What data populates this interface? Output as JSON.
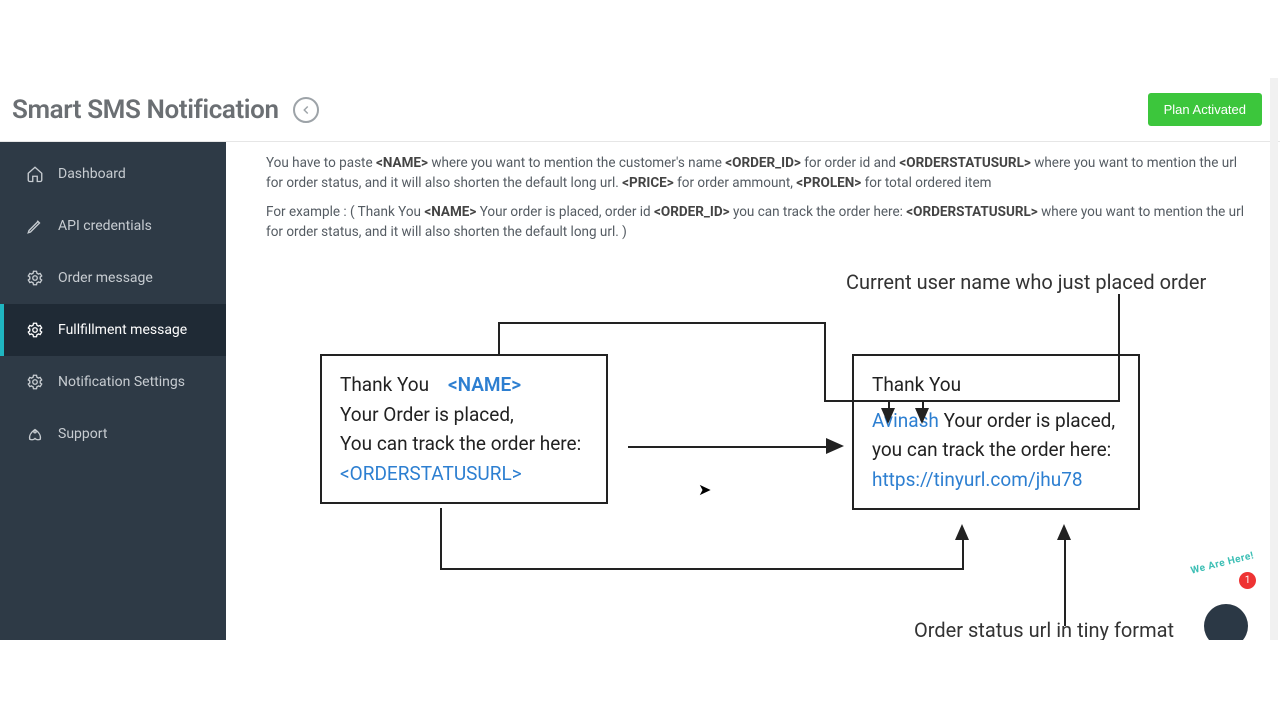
{
  "header": {
    "title": "Smart SMS Notification",
    "plan_button": "Plan Activated"
  },
  "sidebar": {
    "items": [
      {
        "label": "Dashboard",
        "icon": "home"
      },
      {
        "label": "API credentials",
        "icon": "pencil"
      },
      {
        "label": "Order message",
        "icon": "gear"
      },
      {
        "label": "Fullfillment message",
        "icon": "gear"
      },
      {
        "label": "Notification Settings",
        "icon": "gear"
      },
      {
        "label": "Support",
        "icon": "rocket"
      }
    ],
    "active_index": 3
  },
  "help": {
    "p1_pre": "You have to paste ",
    "ph_name": "<NAME>",
    "p1_b": " where you want to mention the customer's name ",
    "ph_order": "<ORDER_ID>",
    "p1_c": " for order id and ",
    "ph_status": "<ORDERSTATUSURL>",
    "p1_d": " where you want to mention the url for order status, and it will also shorten the default long url. ",
    "ph_price": "<PRICE>",
    "p1_e": " for order ammount, ",
    "ph_prolen": "<PROLEN>",
    "p1_f": " for total ordered item",
    "p2_pre": "For example : ( Thank You ",
    "p2_b": " Your order is placed, order id ",
    "p2_c": " you can track the order here: ",
    "p2_d": " where you want to mention the url for order status, and it will also shorten the default long url. )"
  },
  "diagram": {
    "left_box": {
      "l1a": "Thank You",
      "l1b": "<NAME>",
      "l2": "Your Order is placed,",
      "l3": "You can track the order here:",
      "l4": "<ORDERSTATUSURL>"
    },
    "right_box": {
      "l1": "Thank You",
      "l2a": "Avinash",
      "l2b": " Your order is placed, you can track the order here:",
      "l3": "https://tinyurl.com/jhu78"
    },
    "label_top": "Current user name who just placed order",
    "label_bottom": "Order status url in tiny format"
  },
  "chat": {
    "text": "We Are Here!",
    "badge": "1"
  }
}
